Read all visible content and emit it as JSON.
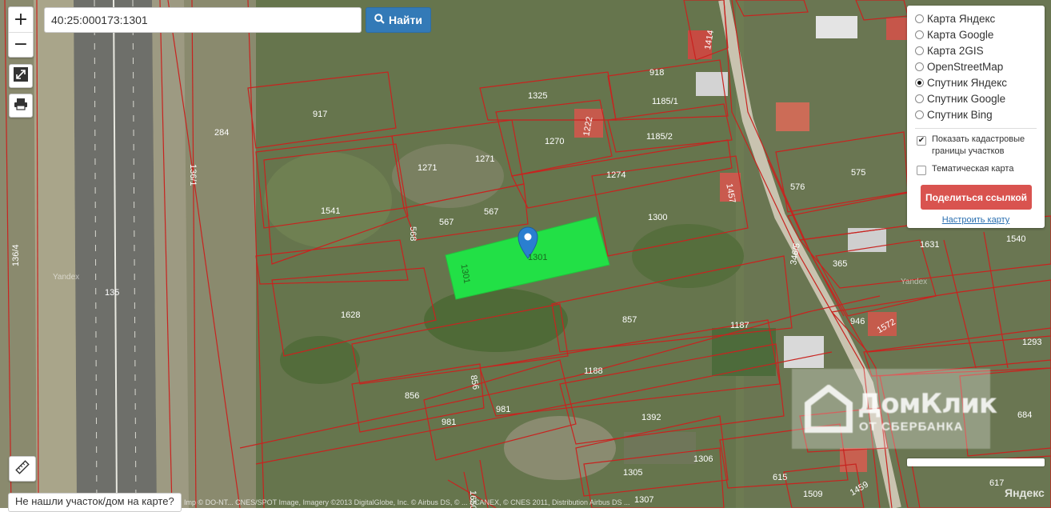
{
  "search": {
    "value": "40:25:000173:1301",
    "button_label": "Найти",
    "button_icon": "search-icon"
  },
  "zoom": {
    "in_label": "+",
    "out_label": "−"
  },
  "tools": {
    "fullscreen_icon": "expand-icon",
    "print_icon": "print-icon",
    "ruler_icon": "ruler-icon"
  },
  "layers": {
    "items": [
      {
        "label": "Карта Яндекс",
        "selected": false
      },
      {
        "label": "Карта Google",
        "selected": false
      },
      {
        "label": "Карта 2GIS",
        "selected": false
      },
      {
        "label": "OpenStreetMap",
        "selected": false
      },
      {
        "label": "Спутник Яндекс",
        "selected": true
      },
      {
        "label": "Спутник Google",
        "selected": false
      },
      {
        "label": "Спутник Bing",
        "selected": false
      }
    ],
    "cadastral_label": "Показать кадастровые границы участков",
    "cadastral_checked": true,
    "thematic_label": "Тематическая карта",
    "thematic_checked": false,
    "share_label": "Поделиться ссылкой",
    "settings_label": "Настроить карту"
  },
  "map": {
    "selected_parcel": "1301",
    "parcel_labels": [
      "917",
      "284",
      "136/1",
      "136/4",
      "135",
      "1325",
      "918",
      "1185/1",
      "1185/2",
      "1270",
      "1222",
      "1271",
      "1271",
      "1274",
      "1541",
      "567",
      "567",
      "568",
      "1300",
      "1457",
      "575",
      "576",
      "346/5",
      "1631",
      "1540",
      "365",
      "1628",
      "857",
      "1187",
      "946",
      "1572",
      "1293",
      "1188",
      "856",
      "856",
      "981",
      "981",
      "1392",
      "1306",
      "1305",
      "1307",
      "615",
      "1509",
      "1459",
      "617",
      "684",
      "1650",
      "1414",
      "1301",
      "1301"
    ],
    "provider_watermarks": [
      "Yandex",
      "Yandex"
    ],
    "colors": {
      "parcel_border": "#c8231f",
      "selected_fill": "#22e046",
      "marker": "#2a7fd0"
    }
  },
  "watermark": {
    "brand": "ДомКлик",
    "subtitle": "ОТ СБЕРБАНКА"
  },
  "bottom": {
    "not_found_label": "Не нашли участок/дом на карте?"
  },
  "footer": {
    "copyright": "Imp © DO-NT... CNES/SPOT Image, Imagery ©2013 DigitalGlobe, Inc. © Airbus DS, © ... SCANEX, © CNES 2011, Distribution Airbus DS ...",
    "logo": "Яндекс"
  }
}
